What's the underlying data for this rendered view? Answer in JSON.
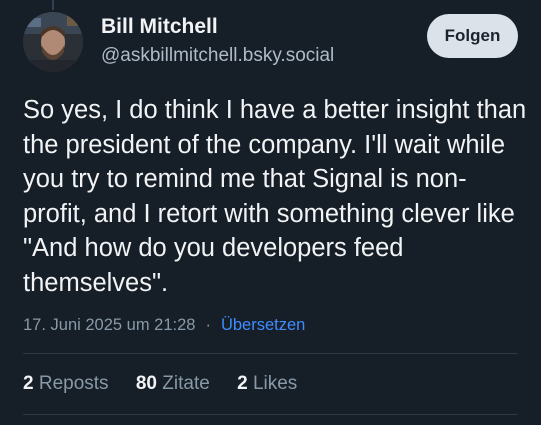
{
  "author": {
    "display_name": "Bill Mitchell",
    "handle": "@askbillmitchell.bsky.social",
    "avatar_icon": "profile-photo"
  },
  "follow_button": {
    "label": "Folgen"
  },
  "post": {
    "text": "So yes, I do think I have a better insight than the president of the company. I'll wait while you try to remind me that Signal is non-profit, and I retort with something clever like \"And how do you developers feed themselves\"."
  },
  "meta": {
    "timestamp": "17. Juni 2025 um 21:28",
    "separator": "·",
    "translate_label": "Übersetzen"
  },
  "stats": {
    "reposts": {
      "count": "2",
      "label": "Reposts"
    },
    "quotes": {
      "count": "80",
      "label": "Zitate"
    },
    "likes": {
      "count": "2",
      "label": "Likes"
    }
  },
  "colors": {
    "background": "#161e27",
    "text": "#f1f3f5",
    "muted": "#8899a8",
    "link": "#3f8cff",
    "button_bg": "#dce2ea"
  }
}
